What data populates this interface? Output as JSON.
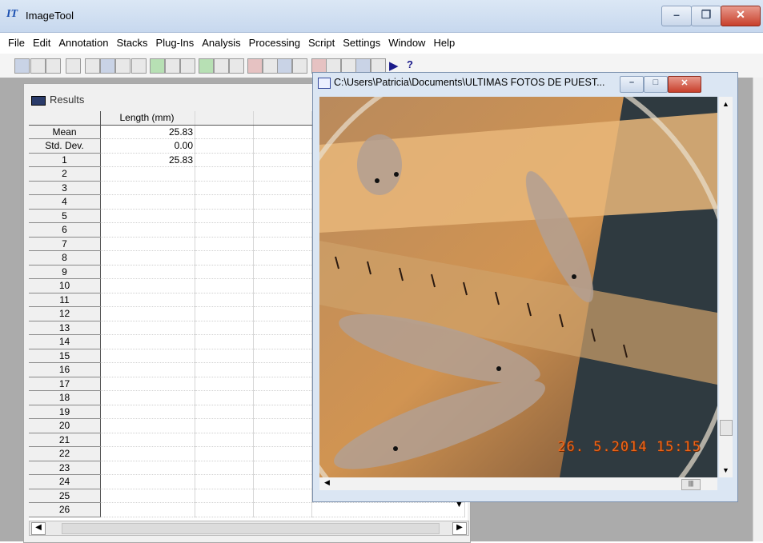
{
  "app": {
    "title": "ImageTool"
  },
  "menu": [
    "File",
    "Edit",
    "Annotation",
    "Stacks",
    "Plug-Ins",
    "Analysis",
    "Processing",
    "Script",
    "Settings",
    "Window",
    "Help"
  ],
  "results": {
    "title": "Results",
    "column_header": "Length (mm)",
    "rows": [
      {
        "label": "Mean",
        "value": "25.83"
      },
      {
        "label": "Std. Dev.",
        "value": "0.00"
      },
      {
        "label": "1",
        "value": "25.83"
      },
      {
        "label": "2",
        "value": ""
      },
      {
        "label": "3",
        "value": ""
      },
      {
        "label": "4",
        "value": ""
      },
      {
        "label": "5",
        "value": ""
      },
      {
        "label": "6",
        "value": ""
      },
      {
        "label": "7",
        "value": ""
      },
      {
        "label": "8",
        "value": ""
      },
      {
        "label": "9",
        "value": ""
      },
      {
        "label": "10",
        "value": ""
      },
      {
        "label": "11",
        "value": ""
      },
      {
        "label": "12",
        "value": ""
      },
      {
        "label": "13",
        "value": ""
      },
      {
        "label": "14",
        "value": ""
      },
      {
        "label": "15",
        "value": ""
      },
      {
        "label": "16",
        "value": ""
      },
      {
        "label": "17",
        "value": ""
      },
      {
        "label": "18",
        "value": ""
      },
      {
        "label": "19",
        "value": ""
      },
      {
        "label": "20",
        "value": ""
      },
      {
        "label": "21",
        "value": ""
      },
      {
        "label": "22",
        "value": ""
      },
      {
        "label": "23",
        "value": ""
      },
      {
        "label": "24",
        "value": ""
      },
      {
        "label": "25",
        "value": ""
      },
      {
        "label": "26",
        "value": ""
      }
    ]
  },
  "image_window": {
    "title": "C:\\Users\\Patricia\\Documents\\ULTIMAS FOTOS DE PUEST...",
    "timestamp": "26. 5.2014  15:15"
  },
  "colors": {
    "title_bar": "#c7d8ee",
    "close_button": "#c8402c",
    "mdi_background": "#ababab"
  },
  "icons": [
    "app-logo-icon",
    "minimize-icon",
    "restore-icon",
    "close-icon",
    "run-script-icon",
    "help-icon"
  ]
}
